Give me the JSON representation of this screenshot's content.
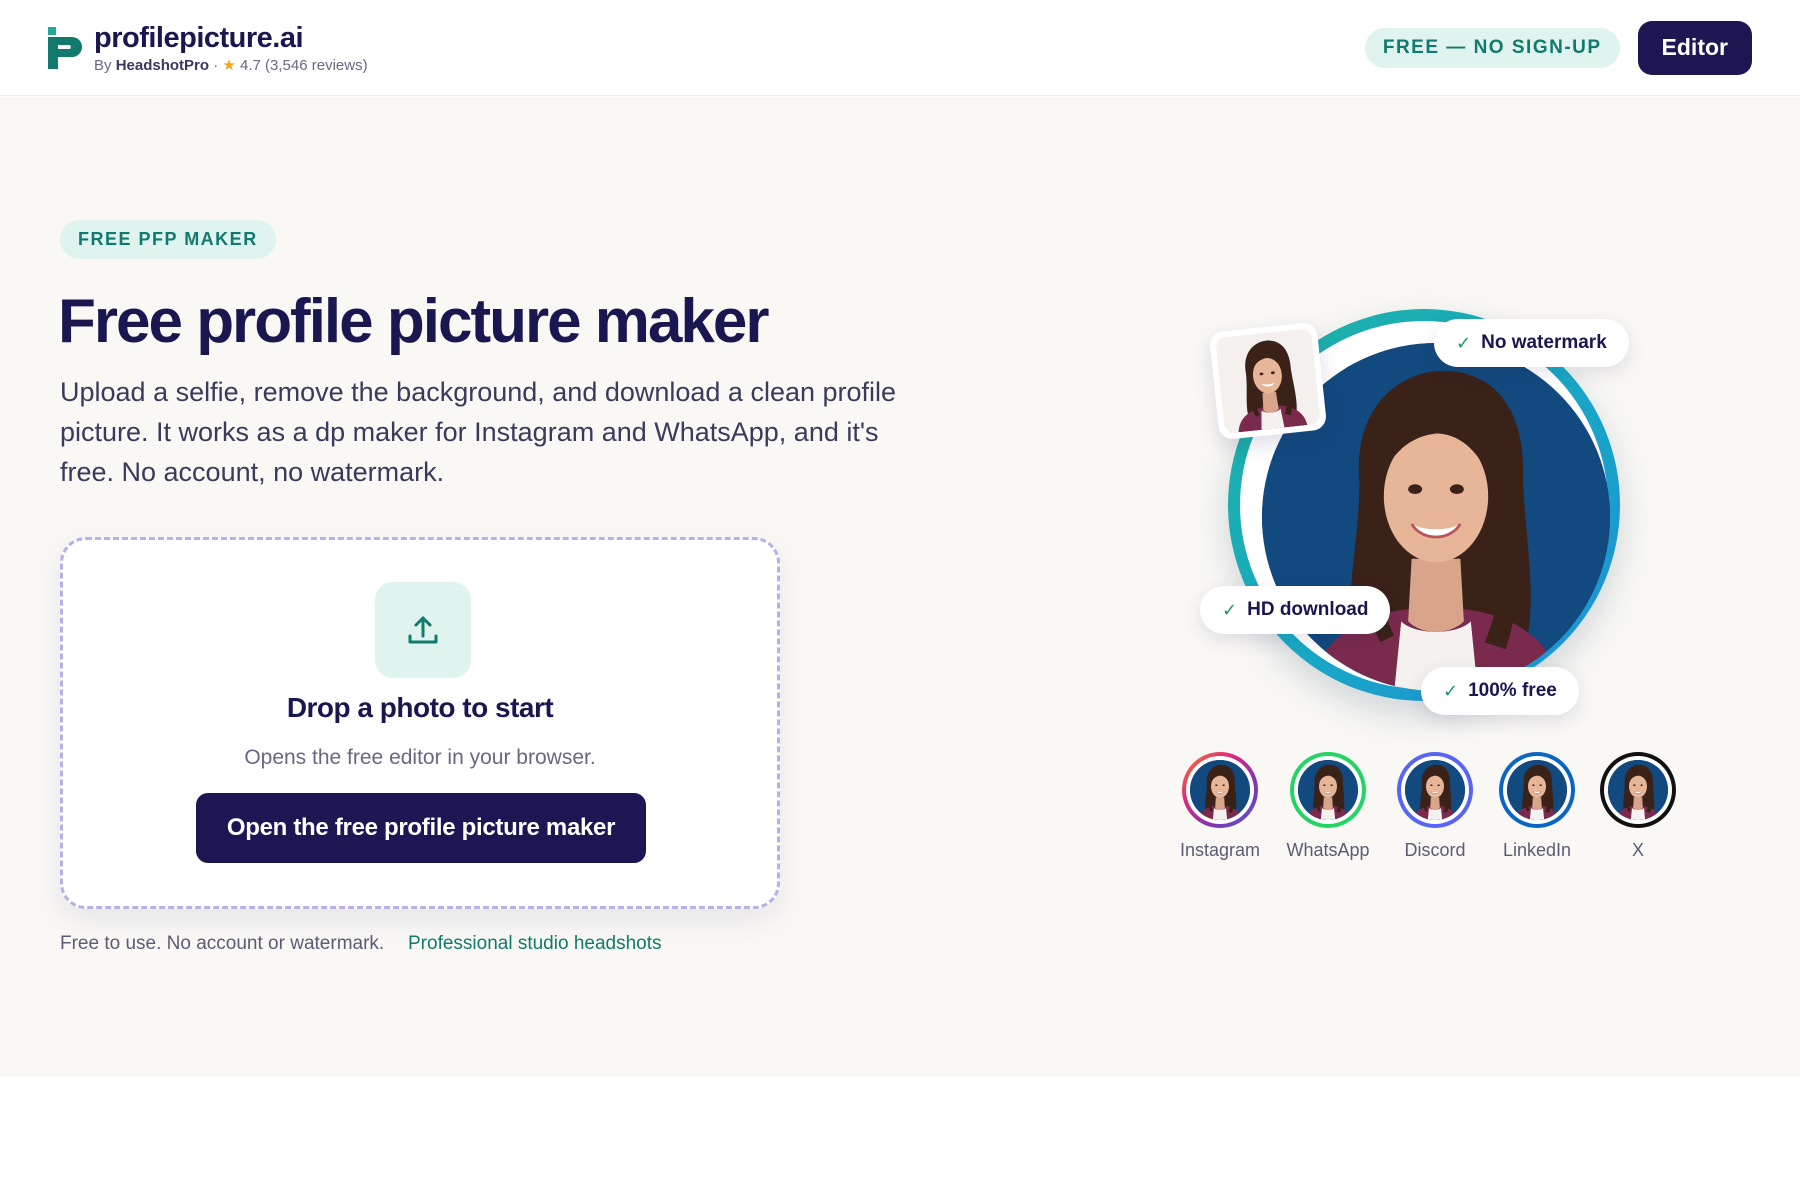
{
  "header": {
    "brand_name": "profilepicture.ai",
    "by_prefix": "By",
    "by_name": "HeadshotPro",
    "rating_text": "4.7 (3,546 reviews)",
    "free_pill": "FREE — NO SIGN-UP",
    "editor_label": "Editor"
  },
  "hero": {
    "badge": "FREE PFP MAKER",
    "title": "Free profile picture maker",
    "description": "Upload a selfie, remove the background, and download a clean profile picture. It works as a dp maker for Instagram and WhatsApp, and it's free. No account, no watermark.",
    "upload": {
      "title": "Drop a photo to start",
      "subtitle": "Opens the free editor in your browser.",
      "button_label": "Open the free profile picture maker"
    },
    "footnote": "Free to use. No account or watermark.",
    "footnote_link": "Professional studio headshots",
    "chips": {
      "no_watermark": "No watermark",
      "hd_download": "HD download",
      "free": "100% free"
    },
    "platforms": [
      {
        "label": "Instagram",
        "ring_color": "#e1306c"
      },
      {
        "label": "WhatsApp",
        "ring_color": "#25d366"
      },
      {
        "label": "Discord",
        "ring_color": "#5865f2"
      },
      {
        "label": "LinkedIn",
        "ring_color": "#0a66c2"
      },
      {
        "label": "X",
        "ring_color": "#111111"
      }
    ]
  },
  "colors": {
    "brand_navy": "#1c1652",
    "accent_teal": "#127a6c",
    "pill_bg": "#dff3ef",
    "hero_bg": "#f9f8f5"
  }
}
